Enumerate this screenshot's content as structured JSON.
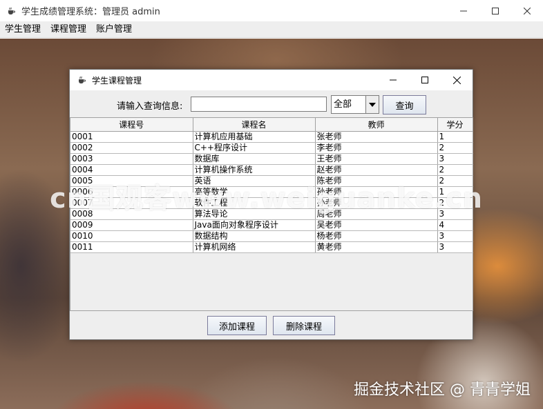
{
  "main_window": {
    "title": "学生成绩管理系统：管理员 admin",
    "icon": "java-cup-icon"
  },
  "menubar": {
    "items": [
      {
        "label": "学生管理"
      },
      {
        "label": "课程管理"
      },
      {
        "label": "账户管理"
      }
    ]
  },
  "dialog": {
    "title": "学生课程管理",
    "icon": "java-cup-icon",
    "search": {
      "label": "请输入查询信息:",
      "input_value": "",
      "select_value": "全部",
      "query_button": "查询"
    },
    "table": {
      "columns": [
        "课程号",
        "课程名",
        "教师",
        "学分"
      ],
      "rows": [
        [
          "0001",
          "计算机应用基础",
          "张老师",
          "1"
        ],
        [
          "0002",
          "C++程序设计",
          "李老师",
          "2"
        ],
        [
          "0003",
          "数据库",
          "王老师",
          "3"
        ],
        [
          "0004",
          "计算机操作系统",
          "赵老师",
          "2"
        ],
        [
          "0005",
          "英语",
          "陈老师",
          "2"
        ],
        [
          "0006",
          "高等数学",
          "孙老师",
          "1"
        ],
        [
          "0007",
          "软件工程",
          "孙老师",
          "2"
        ],
        [
          "0008",
          "算法导论",
          "周老师",
          "3"
        ],
        [
          "0009",
          "Java面向对象程序设计",
          "吴老师",
          "4"
        ],
        [
          "0010",
          "数据结构",
          "杨老师",
          "3"
        ],
        [
          "0011",
          "计算机网络",
          "黄老师",
          "3"
        ]
      ]
    },
    "add_button": "添加课程",
    "delete_button": "删除课程"
  },
  "watermarks": {
    "middle": "cn国观客www.weiguanke.cn",
    "bottom": "掘金技术社区 @ 青青学姐"
  }
}
